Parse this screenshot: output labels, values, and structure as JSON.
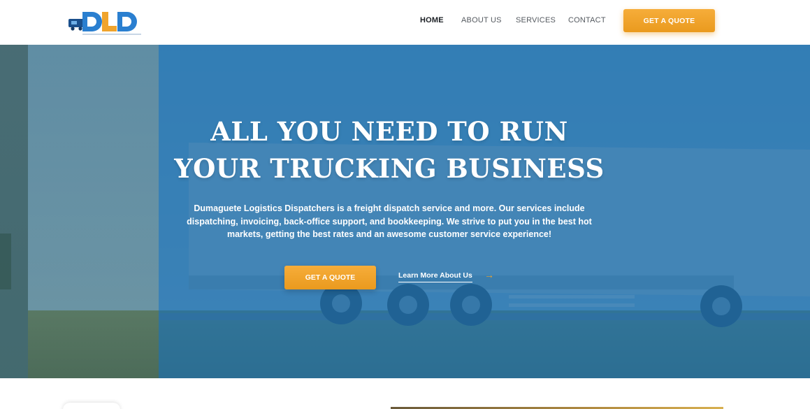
{
  "brand": {
    "logo_letters": "DLD",
    "logo_tagline": "DUMAGUETE LOGISTICS DISPATCHERS",
    "colors": {
      "blue": "#2a7fd0",
      "orange": "#f0a42c",
      "hero_overlay": "#1e6eaa"
    }
  },
  "nav": {
    "items": [
      {
        "label": "HOME",
        "active": true
      },
      {
        "label": "ABOUT US",
        "active": false
      },
      {
        "label": "SERVICES",
        "active": false
      },
      {
        "label": "CONTACT",
        "active": false
      }
    ],
    "cta_label": "GET A QUOTE"
  },
  "hero": {
    "title_line1": "ALL YOU NEED TO RUN",
    "title_line2": "YOUR TRUCKING BUSINESS",
    "description": "Dumaguete Logistics Dispatchers is a freight dispatch service and more. Our services include dispatching, invoicing, back-office support, and bookkeeping. We strive to put you in the best hot markets, getting the best rates and an awesome customer service experience!",
    "primary_button": "GET A QUOTE",
    "secondary_link": "Learn More About Us",
    "secondary_icon": "arrow-right-icon"
  }
}
